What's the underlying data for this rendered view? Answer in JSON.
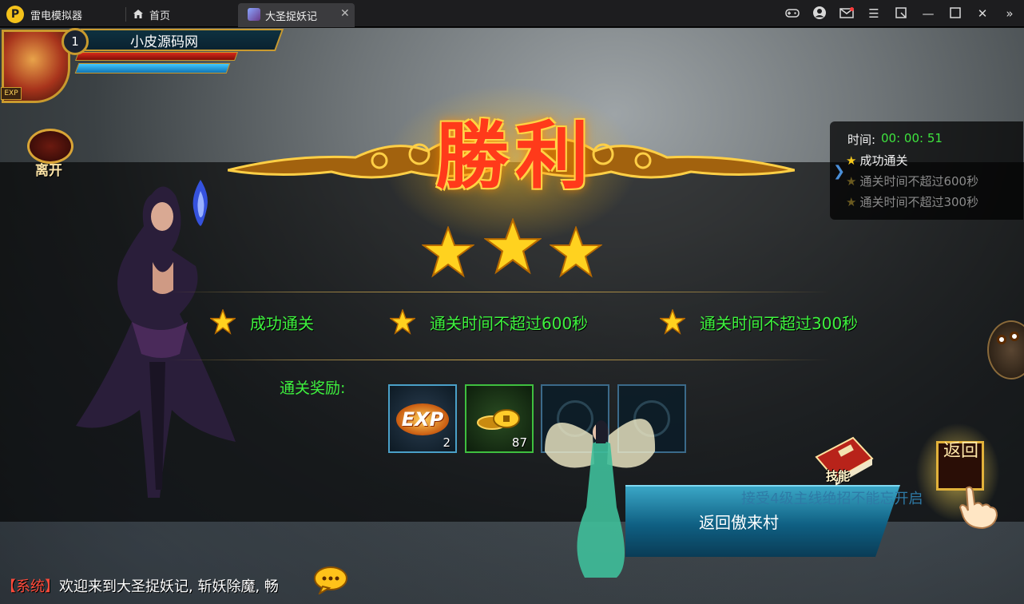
{
  "emulator": {
    "app_name": "雷电模拟器",
    "tabs": [
      {
        "label": "首页",
        "icon": "home-icon"
      },
      {
        "label": "大圣捉妖记",
        "icon": "game-icon",
        "close": "✕"
      }
    ],
    "controls": [
      "gamepad-icon",
      "account-icon",
      "mail-icon",
      "menu-icon",
      "popout-icon",
      "minimize-icon",
      "maximize-icon",
      "close-icon",
      "collapse-icon"
    ]
  },
  "player": {
    "name": "小皮源码网",
    "level": "1",
    "exp_tag": "EXP",
    "hp_fill": 1.0,
    "mp_fill": 0.95
  },
  "leave": {
    "label": "离开"
  },
  "objectives": {
    "time_label": "时间:",
    "time_value": "00: 00: 51",
    "items": [
      {
        "label": "成功通关",
        "done": true
      },
      {
        "label": "通关时间不超过600秒",
        "done": false
      },
      {
        "label": "通关时间不超过300秒",
        "done": false
      }
    ]
  },
  "victory": {
    "title": "勝利",
    "stars_earned": 3,
    "stars_total": 3
  },
  "conditions": [
    {
      "label": "成功通关"
    },
    {
      "label": "通关时间不超过600秒"
    },
    {
      "label": "通关时间不超过300秒"
    }
  ],
  "rewards": {
    "title": "通关奖励:",
    "items": [
      {
        "name": "EXP",
        "count": "2"
      },
      {
        "name": "gold-coins",
        "count": "87"
      },
      {
        "name": "empty",
        "count": ""
      },
      {
        "name": "empty",
        "count": ""
      }
    ]
  },
  "skill": {
    "label": "技能"
  },
  "return_btn": {
    "label": "返回"
  },
  "quest": {
    "hint": "接受4级主线绝招不能忘开启",
    "button": "返回傲来村"
  },
  "chat": {
    "tag": "【系统】",
    "message": "欢迎来到大圣捉妖记, 斩妖除魔, 畅"
  },
  "colors": {
    "accent_green": "#3ef23e",
    "gold": "#f6c91c",
    "victory_red": "#ff3a1a"
  }
}
